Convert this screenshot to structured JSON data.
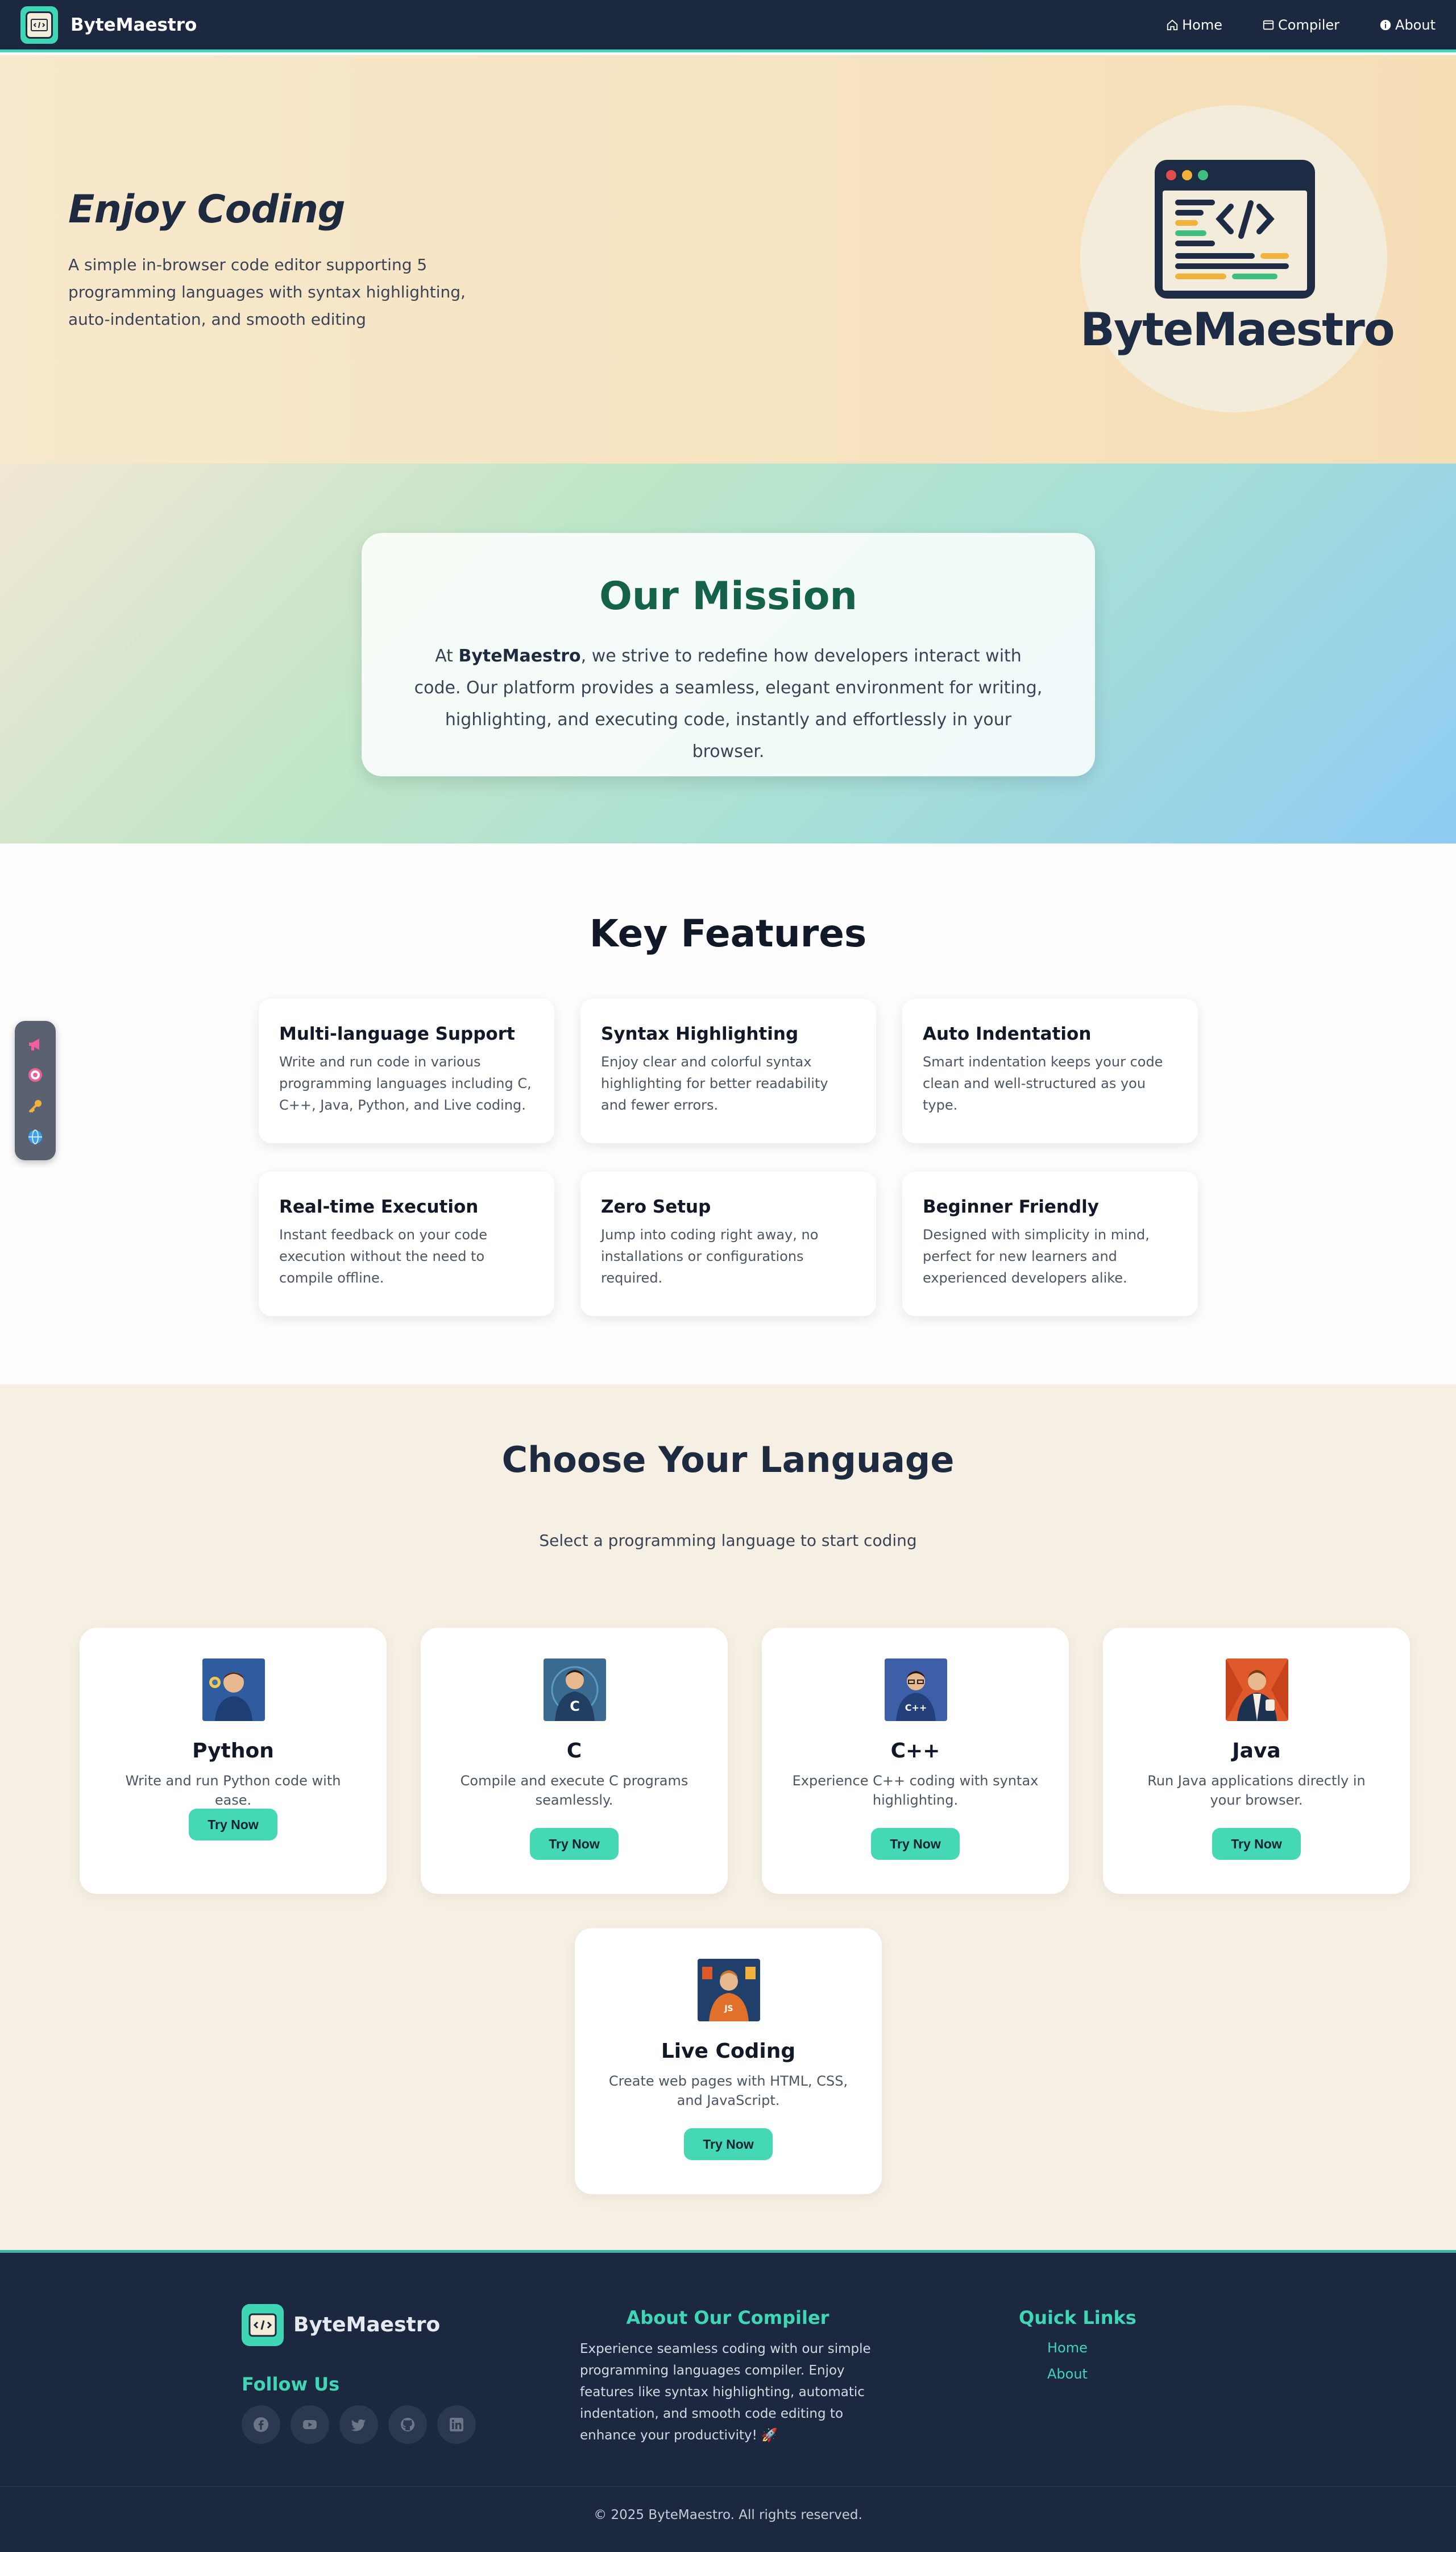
{
  "navbar": {
    "brand": "ByteMaestro",
    "links": [
      {
        "label": "Home",
        "icon": "home-icon"
      },
      {
        "label": "Compiler",
        "icon": "window-icon"
      },
      {
        "label": "About",
        "icon": "info-icon"
      }
    ]
  },
  "hero": {
    "title": "Enjoy Coding",
    "description": "A simple in-browser code editor supporting 5 programming languages with syntax highlighting, auto-indentation, and smooth editing",
    "logo_text": "ByteMaestro"
  },
  "mission": {
    "title": "Our Mission",
    "text_before": "At ",
    "brand": "ByteMaestro",
    "text_after": ", we strive to redefine how developers interact with code. Our platform provides a seamless, elegant environment for writing, highlighting, and executing code, instantly and effortlessly in your browser."
  },
  "features": {
    "title": "Key Features",
    "items": [
      {
        "title": "Multi-language Support",
        "desc": "Write and run code in various programming languages including C, C++, Java, Python, and Live coding."
      },
      {
        "title": "Syntax Highlighting",
        "desc": "Enjoy clear and colorful syntax highlighting for better readability and fewer errors."
      },
      {
        "title": "Auto Indentation",
        "desc": "Smart indentation keeps your code clean and well-structured as you type."
      },
      {
        "title": "Real-time Execution",
        "desc": "Instant feedback on your code execution without the need to compile offline."
      },
      {
        "title": "Zero Setup",
        "desc": "Jump into coding right away, no installations or configurations required."
      },
      {
        "title": "Beginner Friendly",
        "desc": "Designed with simplicity in mind, perfect for new learners and experienced developers alike."
      }
    ]
  },
  "floating_bar": {
    "items": [
      "megaphone-icon",
      "target-icon",
      "key-icon",
      "globe-icon"
    ]
  },
  "languages": {
    "title": "Choose Your Language",
    "subtitle": "Select a programming language to start coding",
    "items": [
      {
        "name": "Python",
        "desc": "Write and run Python code with ease.",
        "button": "Try Now"
      },
      {
        "name": "C",
        "desc": "Compile and execute C programs seamlessly.",
        "button": "Try Now"
      },
      {
        "name": "C++",
        "desc": "Experience C++ coding with syntax highlighting.",
        "button": "Try Now"
      },
      {
        "name": "Java",
        "desc": "Run Java applications directly in your browser.",
        "button": "Try Now"
      },
      {
        "name": "Live Coding",
        "desc": "Create web pages with HTML, CSS, and JavaScript.",
        "button": "Try Now"
      }
    ]
  },
  "footer": {
    "brand": "ByteMaestro",
    "follow_title": "Follow Us",
    "socials": [
      "facebook-icon",
      "youtube-icon",
      "twitter-icon",
      "github-icon",
      "linkedin-icon"
    ],
    "about_title": "About Our Compiler",
    "about_text": "Experience seamless coding with our simple programming languages compiler. Enjoy features like syntax highlighting, automatic indentation, and smooth code editing to enhance your productivity! 🚀",
    "links_title": "Quick Links",
    "links": [
      "Home",
      "About"
    ],
    "copyright": "© 2025 ByteMaestro. All rights reserved."
  },
  "colors": {
    "navy": "#1b2840",
    "accent": "#3fd6b6",
    "mission_green": "#14624a"
  }
}
